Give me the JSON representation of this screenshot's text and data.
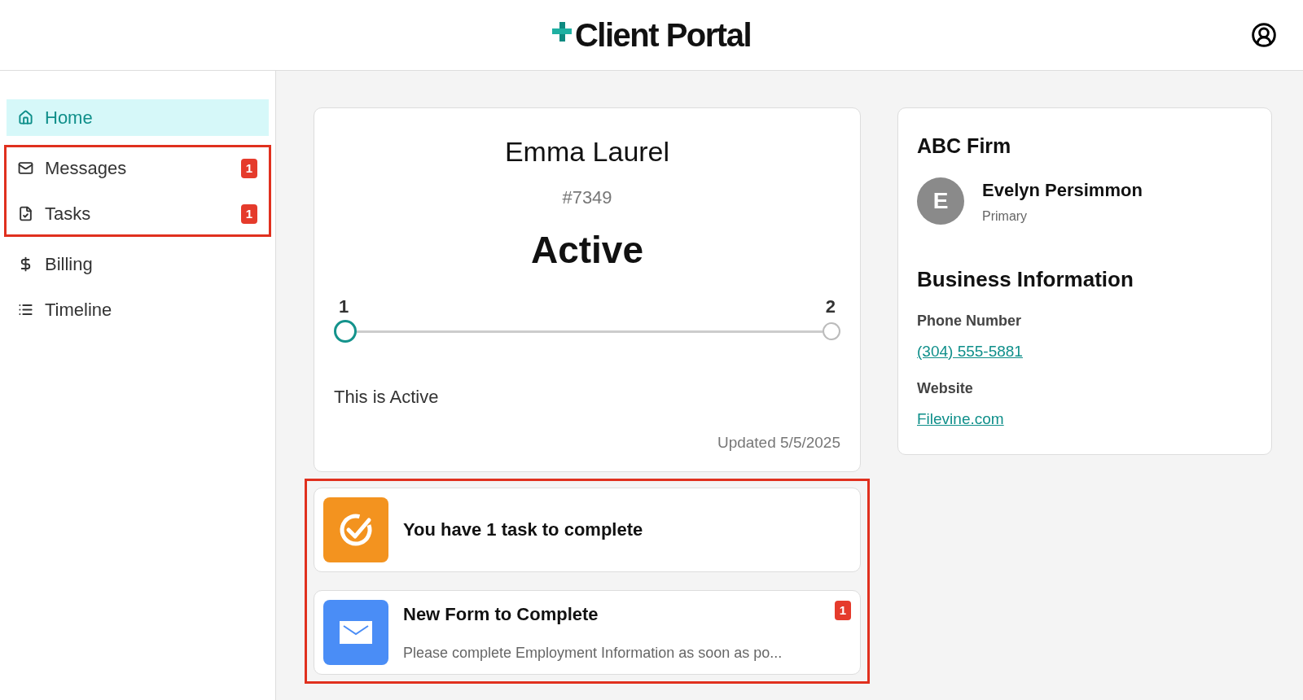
{
  "header": {
    "logo_text": "Client Portal"
  },
  "sidebar": {
    "groups": [
      {
        "highlighted": false,
        "items": [
          {
            "kind": "home",
            "label": "Home",
            "selected": true
          }
        ]
      },
      {
        "highlighted": true,
        "items": [
          {
            "kind": "messages",
            "label": "Messages",
            "selected": false,
            "badge": "1"
          },
          {
            "kind": "tasks",
            "label": "Tasks",
            "selected": false,
            "badge": "1"
          }
        ]
      },
      {
        "highlighted": false,
        "items": [
          {
            "kind": "billing",
            "label": "Billing",
            "selected": false
          },
          {
            "kind": "timeline",
            "label": "Timeline",
            "selected": false
          }
        ]
      }
    ]
  },
  "case": {
    "name": "Emma Laurel",
    "number": "#7349",
    "status": "Active",
    "steps": [
      {
        "label": "1",
        "selected": true
      },
      {
        "label": "2",
        "selected": false
      }
    ],
    "description": "This is Active",
    "updated": "Updated 5/5/2025"
  },
  "notifications": {
    "highlighted": true,
    "cards": [
      {
        "kind": "task",
        "title": "You have 1 task to complete"
      },
      {
        "kind": "form",
        "title": "New Form to Complete",
        "text": "Please complete Employment Information as soon as po...",
        "badge": "1"
      }
    ]
  },
  "firm": {
    "name": "ABC Firm",
    "contact": {
      "initial": "E",
      "name": "Evelyn Persimmon",
      "role": "Primary"
    },
    "section_title": "Business Information",
    "fields": [
      {
        "label": "Phone Number",
        "value": "(304) 555-5881"
      },
      {
        "label": "Website",
        "value": "Filevine.com"
      }
    ]
  }
}
